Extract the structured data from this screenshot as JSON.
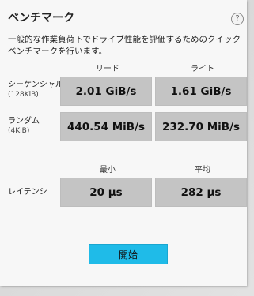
{
  "dialog": {
    "title": "ベンチマーク",
    "help_glyph": "?",
    "description": "一般的な作業負荷下でドライブ性能を評価するためのクイックベンチマークを行います。"
  },
  "throughput": {
    "col_read": "リード",
    "col_write": "ライト",
    "rows": [
      {
        "label": "シーケンシャル",
        "sub": "(128KiB)",
        "read": "2.01 GiB/s",
        "write": "1.61 GiB/s"
      },
      {
        "label": "ランダム",
        "sub": "(4KiB)",
        "read": "440.54 MiB/s",
        "write": "232.70 MiB/s"
      }
    ]
  },
  "latency": {
    "col_min": "最小",
    "col_avg": "平均",
    "label": "レイテンシ",
    "min": "20 µs",
    "avg": "282 µs"
  },
  "actions": {
    "start_label": "開始"
  },
  "colors": {
    "accent": "#1fbbe8",
    "value_box": "#c4c4c4",
    "panel": "#f7f7f7"
  }
}
